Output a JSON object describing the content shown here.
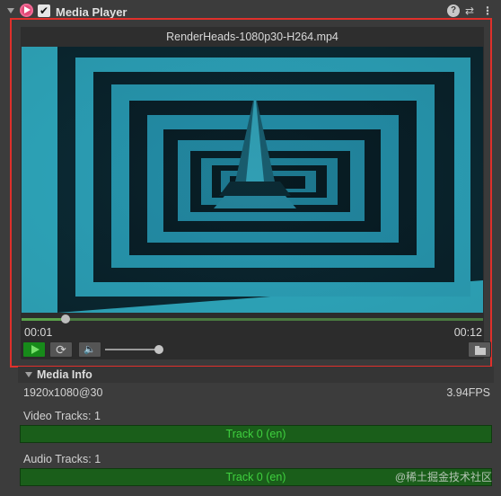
{
  "component": {
    "title": "Media Player",
    "enabled_check": "✔",
    "help_icon": "?",
    "preset_icon": "⇄",
    "more_icon": "⋮"
  },
  "player": {
    "filename": "RenderHeads-1080p30-H264.mp4",
    "current_time": "00:01",
    "duration": "00:12",
    "progress_fraction": 0.095,
    "volume_fraction": 1.0,
    "loop_icon": "⟳",
    "mute_icon": "🔈"
  },
  "media_info": {
    "title": "Media Info",
    "resolution": "1920x1080@30",
    "fps": "3.94FPS",
    "video_tracks_label": "Video Tracks: 1",
    "video_track": "Track 0 (en)",
    "audio_tracks_label": "Audio Tracks: 1",
    "audio_track": "Track 0 (en)"
  },
  "watermark": "@稀土掘金技术社区",
  "colors": {
    "highlight": "#e0302b",
    "video_cyan": "#35cbe6",
    "track_green": "#1a5e1a",
    "track_text": "#3fd03f"
  }
}
